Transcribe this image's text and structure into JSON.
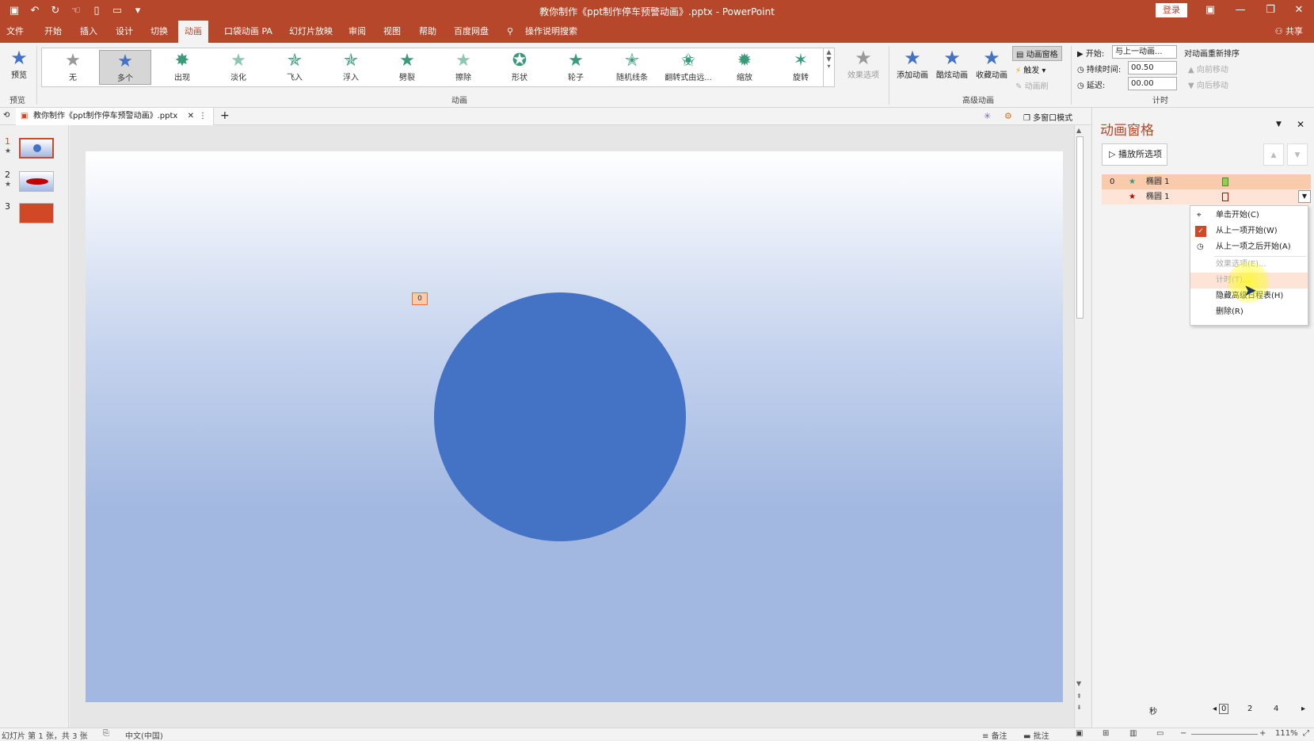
{
  "app": {
    "title": "教你制作《ppt制作停车预警动画》.pptx  -  PowerPoint",
    "login": "登录",
    "share": "共享"
  },
  "qat_icons": [
    "save-icon",
    "undo-icon",
    "redo-icon",
    "touch-icon",
    "new-icon",
    "open-icon",
    "customize-icon"
  ],
  "menu": [
    "文件",
    "开始",
    "插入",
    "设计",
    "切换",
    "动画",
    "口袋动画 PA",
    "幻灯片放映",
    "审阅",
    "视图",
    "帮助",
    "百度网盘",
    "操作说明搜索"
  ],
  "active_menu": "动画",
  "ribbon": {
    "preview": {
      "label": "预览",
      "group": "预览"
    },
    "gallery": [
      "无",
      "多个",
      "出现",
      "淡化",
      "飞入",
      "浮入",
      "劈裂",
      "擦除",
      "形状",
      "轮子",
      "随机线条",
      "翻转式由远...",
      "缩放",
      "旋转"
    ],
    "gallery_selected": "多个",
    "effect_options": "效果选项",
    "group_animation": "动画",
    "add_animation": "添加动画",
    "cool_animation": "酷炫动画",
    "fav_animation": "收藏动画",
    "anim_pane": "动画窗格",
    "trigger": "触发",
    "anim_painter": "动画刷",
    "group_advanced": "高级动画",
    "start_label": "开始:",
    "start_value": "与上一动画...",
    "duration_label": "持续时间:",
    "duration_value": "00.50",
    "delay_label": "延迟:",
    "delay_value": "00.00",
    "reorder": "对动画重新排序",
    "move_earlier": "向前移动",
    "move_later": "向后移动",
    "group_timing": "计时"
  },
  "tabs": {
    "doc_tab": "教你制作《ppt制作停车预警动画》.pptx",
    "multiwindow": "多窗口模式"
  },
  "thumbs": [
    {
      "num": "1",
      "star": "★"
    },
    {
      "num": "2",
      "star": "★"
    },
    {
      "num": "3",
      "star": ""
    }
  ],
  "slide": {
    "anim_tag": "0"
  },
  "pane": {
    "title": "动画窗格",
    "play": "播放所选项",
    "rows": [
      {
        "index": "0",
        "name": "椭圆 1"
      },
      {
        "index": "",
        "name": "椭圆 1"
      }
    ]
  },
  "context_menu": [
    "单击开始(C)",
    "从上一项开始(W)",
    "从上一项之后开始(A)",
    "效果选项(E)...",
    "计时(T)...",
    "隐藏高级日程表(H)",
    "删除(R)"
  ],
  "timeline": {
    "unit": "秒",
    "ticks": [
      "0",
      "2",
      "4"
    ]
  },
  "status": {
    "slide_info": "幻灯片 第 1 张，共 3 张",
    "lang": "中文(中国)",
    "notes": "备注",
    "comments": "批注",
    "zoom": "111%"
  },
  "colors": {
    "brand": "#b7472a",
    "shape": "#4472c4",
    "highlight": "#f8cbad"
  }
}
